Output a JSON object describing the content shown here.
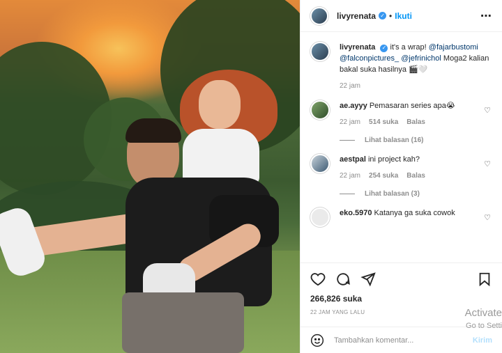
{
  "header": {
    "username": "livyrenata",
    "dot": "•",
    "follow_label": "Ikuti",
    "more_icon": "more-horizontal-icon"
  },
  "caption": {
    "username": "livyrenata",
    "text_prefix": "it's a wrap!",
    "mentions": [
      "@fajarbustomi",
      "@falconpictures_",
      "@jefrinichol"
    ],
    "text_suffix": "Moga2 kalian bakal suka hasilnya 🎬🤍",
    "time": "22 jam"
  },
  "comments": [
    {
      "username": "ae.ayyy",
      "text": "Pemasaran series apa😭",
      "time": "22 jam",
      "likes": "514 suka",
      "reply_label": "Balas",
      "replies_label": "Lihat balasan (16)"
    },
    {
      "username": "aestpal",
      "text": "ini project kah?",
      "time": "22 jam",
      "likes": "254 suka",
      "reply_label": "Balas",
      "replies_label": "Lihat balasan (3)"
    },
    {
      "username": "eko.5970",
      "text": "Katanya ga suka cowok"
    }
  ],
  "actions": {
    "like_icon": "heart-icon",
    "comment_icon": "comment-icon",
    "share_icon": "send-icon",
    "save_icon": "bookmark-icon",
    "likes_count": "266,826 suka",
    "timestamp": "22 JAM YANG LALU"
  },
  "composer": {
    "emoji_icon": "emoji-icon",
    "placeholder": "Tambahkan komentar...",
    "send_label": "Kirim"
  },
  "watermark": {
    "line1": "Activate",
    "line2": "Go to Setti"
  }
}
